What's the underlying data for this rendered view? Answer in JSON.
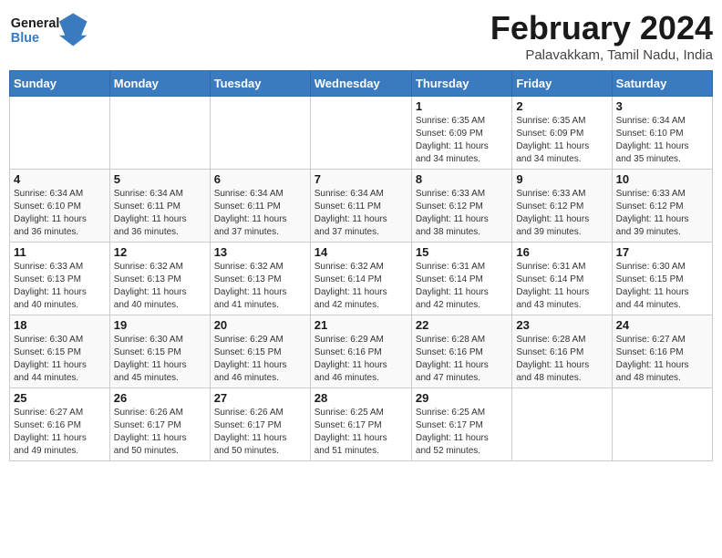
{
  "logo": {
    "general": "General",
    "blue": "Blue"
  },
  "title": "February 2024",
  "location": "Palavakkam, Tamil Nadu, India",
  "weekdays": [
    "Sunday",
    "Monday",
    "Tuesday",
    "Wednesday",
    "Thursday",
    "Friday",
    "Saturday"
  ],
  "weeks": [
    [
      {
        "day": "",
        "info": ""
      },
      {
        "day": "",
        "info": ""
      },
      {
        "day": "",
        "info": ""
      },
      {
        "day": "",
        "info": ""
      },
      {
        "day": "1",
        "info": "Sunrise: 6:35 AM\nSunset: 6:09 PM\nDaylight: 11 hours\nand 34 minutes."
      },
      {
        "day": "2",
        "info": "Sunrise: 6:35 AM\nSunset: 6:09 PM\nDaylight: 11 hours\nand 34 minutes."
      },
      {
        "day": "3",
        "info": "Sunrise: 6:34 AM\nSunset: 6:10 PM\nDaylight: 11 hours\nand 35 minutes."
      }
    ],
    [
      {
        "day": "4",
        "info": "Sunrise: 6:34 AM\nSunset: 6:10 PM\nDaylight: 11 hours\nand 36 minutes."
      },
      {
        "day": "5",
        "info": "Sunrise: 6:34 AM\nSunset: 6:11 PM\nDaylight: 11 hours\nand 36 minutes."
      },
      {
        "day": "6",
        "info": "Sunrise: 6:34 AM\nSunset: 6:11 PM\nDaylight: 11 hours\nand 37 minutes."
      },
      {
        "day": "7",
        "info": "Sunrise: 6:34 AM\nSunset: 6:11 PM\nDaylight: 11 hours\nand 37 minutes."
      },
      {
        "day": "8",
        "info": "Sunrise: 6:33 AM\nSunset: 6:12 PM\nDaylight: 11 hours\nand 38 minutes."
      },
      {
        "day": "9",
        "info": "Sunrise: 6:33 AM\nSunset: 6:12 PM\nDaylight: 11 hours\nand 39 minutes."
      },
      {
        "day": "10",
        "info": "Sunrise: 6:33 AM\nSunset: 6:12 PM\nDaylight: 11 hours\nand 39 minutes."
      }
    ],
    [
      {
        "day": "11",
        "info": "Sunrise: 6:33 AM\nSunset: 6:13 PM\nDaylight: 11 hours\nand 40 minutes."
      },
      {
        "day": "12",
        "info": "Sunrise: 6:32 AM\nSunset: 6:13 PM\nDaylight: 11 hours\nand 40 minutes."
      },
      {
        "day": "13",
        "info": "Sunrise: 6:32 AM\nSunset: 6:13 PM\nDaylight: 11 hours\nand 41 minutes."
      },
      {
        "day": "14",
        "info": "Sunrise: 6:32 AM\nSunset: 6:14 PM\nDaylight: 11 hours\nand 42 minutes."
      },
      {
        "day": "15",
        "info": "Sunrise: 6:31 AM\nSunset: 6:14 PM\nDaylight: 11 hours\nand 42 minutes."
      },
      {
        "day": "16",
        "info": "Sunrise: 6:31 AM\nSunset: 6:14 PM\nDaylight: 11 hours\nand 43 minutes."
      },
      {
        "day": "17",
        "info": "Sunrise: 6:30 AM\nSunset: 6:15 PM\nDaylight: 11 hours\nand 44 minutes."
      }
    ],
    [
      {
        "day": "18",
        "info": "Sunrise: 6:30 AM\nSunset: 6:15 PM\nDaylight: 11 hours\nand 44 minutes."
      },
      {
        "day": "19",
        "info": "Sunrise: 6:30 AM\nSunset: 6:15 PM\nDaylight: 11 hours\nand 45 minutes."
      },
      {
        "day": "20",
        "info": "Sunrise: 6:29 AM\nSunset: 6:15 PM\nDaylight: 11 hours\nand 46 minutes."
      },
      {
        "day": "21",
        "info": "Sunrise: 6:29 AM\nSunset: 6:16 PM\nDaylight: 11 hours\nand 46 minutes."
      },
      {
        "day": "22",
        "info": "Sunrise: 6:28 AM\nSunset: 6:16 PM\nDaylight: 11 hours\nand 47 minutes."
      },
      {
        "day": "23",
        "info": "Sunrise: 6:28 AM\nSunset: 6:16 PM\nDaylight: 11 hours\nand 48 minutes."
      },
      {
        "day": "24",
        "info": "Sunrise: 6:27 AM\nSunset: 6:16 PM\nDaylight: 11 hours\nand 48 minutes."
      }
    ],
    [
      {
        "day": "25",
        "info": "Sunrise: 6:27 AM\nSunset: 6:16 PM\nDaylight: 11 hours\nand 49 minutes."
      },
      {
        "day": "26",
        "info": "Sunrise: 6:26 AM\nSunset: 6:17 PM\nDaylight: 11 hours\nand 50 minutes."
      },
      {
        "day": "27",
        "info": "Sunrise: 6:26 AM\nSunset: 6:17 PM\nDaylight: 11 hours\nand 50 minutes."
      },
      {
        "day": "28",
        "info": "Sunrise: 6:25 AM\nSunset: 6:17 PM\nDaylight: 11 hours\nand 51 minutes."
      },
      {
        "day": "29",
        "info": "Sunrise: 6:25 AM\nSunset: 6:17 PM\nDaylight: 11 hours\nand 52 minutes."
      },
      {
        "day": "",
        "info": ""
      },
      {
        "day": "",
        "info": ""
      }
    ]
  ]
}
